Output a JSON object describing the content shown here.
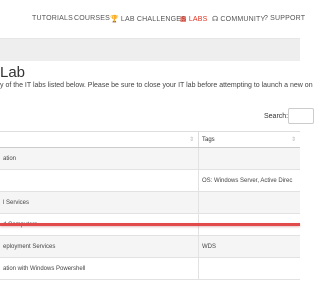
{
  "nav": {
    "items": [
      {
        "label": "TUTORIALS",
        "icon": "",
        "active": false
      },
      {
        "label": "COURSES",
        "icon": "",
        "active": false
      },
      {
        "label": "LAB CHALLENGES",
        "icon": "trophy-icon",
        "active": false
      },
      {
        "label": "LABS",
        "icon": "labs-icon",
        "active": true
      },
      {
        "label": "COMMUNITY",
        "icon": "community-icon",
        "active": false
      },
      {
        "label": "SUPPORT",
        "icon": "support-icon",
        "active": false
      }
    ]
  },
  "page": {
    "title": "Lab",
    "intro": "y of the IT labs listed below. Please be sure to close your IT lab before attempting to launch a new on"
  },
  "search": {
    "label": "Search:",
    "value": ""
  },
  "table": {
    "headers": [
      "",
      "Tags"
    ],
    "rows": [
      {
        "name": "ation",
        "tags": ""
      },
      {
        "name": "",
        "tags": "OS: Windows Server, Active Direc"
      },
      {
        "name": "l Services",
        "tags": ""
      },
      {
        "name": "d Computers",
        "tags": ""
      },
      {
        "name": "eployment Services",
        "tags": "WDS"
      },
      {
        "name": "ation with Windows Powershell",
        "tags": ""
      }
    ]
  },
  "colors": {
    "accent": "#e0301e",
    "highlight_line": "#e04a4a"
  }
}
